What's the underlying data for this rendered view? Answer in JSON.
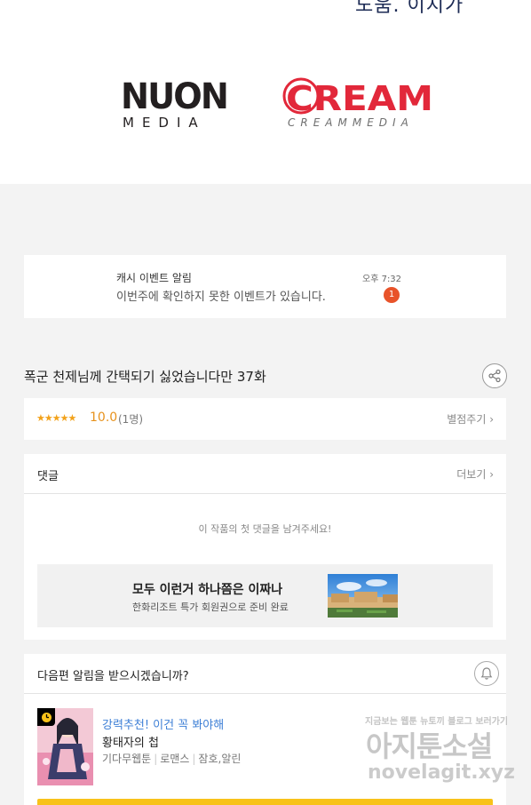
{
  "header": {
    "cut_text": "도움. 이지가"
  },
  "logos": {
    "left": {
      "top_text": "NUON",
      "bottom_text": "MEDIA"
    },
    "right": {
      "top_text": "CREAM",
      "bottom_text": "CREAMMEDIA"
    }
  },
  "notification": {
    "title": "캐시 이벤트 알림",
    "body": "이번주에 확인하지 못한 이벤트가 있습니다.",
    "time": "오후 7:32",
    "badge": "1"
  },
  "episode": {
    "title": "폭군 천제님께 간택되기 싫었습니다만 37화",
    "share_icon": "share-icon"
  },
  "rating": {
    "stars": "★★★★★",
    "score": "10.0",
    "count": "(1명)",
    "action": "별점주기 ›"
  },
  "comments": {
    "title": "댓글",
    "more": "더보기 ›",
    "empty_message": "이 작품의 첫 댓글을 남겨주세요!",
    "ad": {
      "title": "모두 이런거 하나쯤은 이짜나",
      "subtitle": "한화리조트 특가 회원권으로 준비 완료"
    }
  },
  "next_alert": {
    "title": "다음편 알림을 받으시겠습니까?",
    "bell_icon": "bell-icon"
  },
  "recommendation": {
    "tag": "강력추천! 이건 꼭 봐야해",
    "title": "황태자의 첩",
    "meta": [
      "기다무웹툰",
      "로맨스",
      "잠호,알린"
    ]
  },
  "watermark": {
    "small": "지금보는 웹툰 뉴토끼 블로그 보러가기",
    "big": "아지툰소설",
    "url": "novelagit.xyz"
  },
  "colors": {
    "accent_orange": "#e7921c",
    "badge_red": "#e8532a",
    "link_blue": "#3d7fd6",
    "bar_yellow": "#f8c21a",
    "cream_red": "#e2283a"
  }
}
